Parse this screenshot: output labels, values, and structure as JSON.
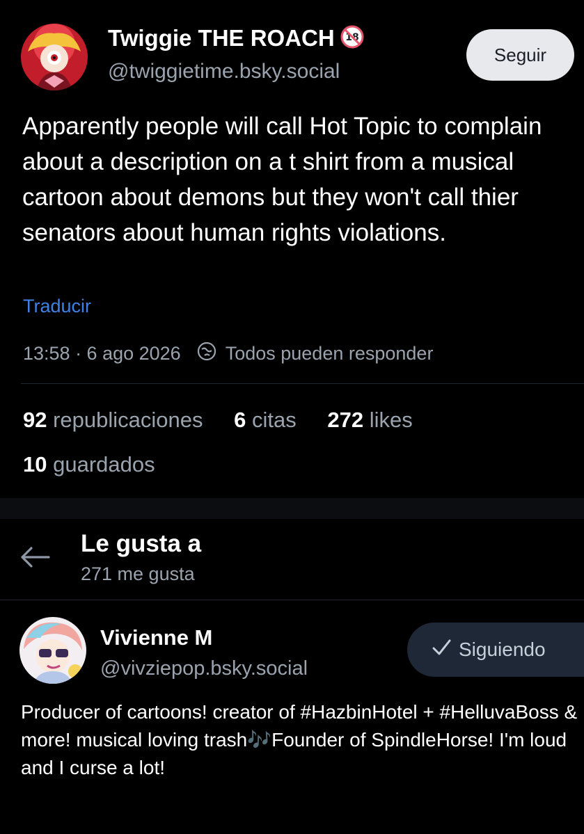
{
  "post": {
    "author_name": "Twiggie THE ROACH",
    "author_handle": "@twiggietime.bsky.social",
    "follow_label": "Seguir",
    "text": "Apparently people will call Hot Topic to complain about a description on a t shirt from a musical cartoon about demons but they won't call thier senators about human rights violations.",
    "translate_label": "Traducir",
    "timestamp": "13:58 · 6 ago 2026",
    "reply_setting": "Todos pueden responder",
    "stats": {
      "reposts_count": "92",
      "reposts_label": "republicaciones",
      "quotes_count": "6",
      "quotes_label": "citas",
      "likes_count": "272",
      "likes_label": "likes",
      "saves_count": "10",
      "saves_label": "guardados"
    }
  },
  "likes_view": {
    "title": "Le gusta a",
    "subtitle": "271 me gusta"
  },
  "liker": {
    "name": "Vivienne M",
    "handle": "@vivziepop.bsky.social",
    "following_label": "Siguiendo",
    "bio": "Producer of cartoons! creator of #HazbinHotel + #HelluvaBoss & more! musical loving trash🎶Founder of SpindleHorse! I'm loud and I curse a lot!"
  },
  "colors": {
    "background": "#000000",
    "muted_text": "#9aa3ae",
    "link": "#3e82e6",
    "follow_button_bg": "#e8e9ec",
    "following_button_bg": "#1f2836",
    "adult_badge": "#e5546a"
  },
  "icons": {
    "adult_badge": "18-plus-icon",
    "reply_setting": "globe-reply-icon",
    "back": "arrow-left-icon",
    "following": "check-icon"
  }
}
